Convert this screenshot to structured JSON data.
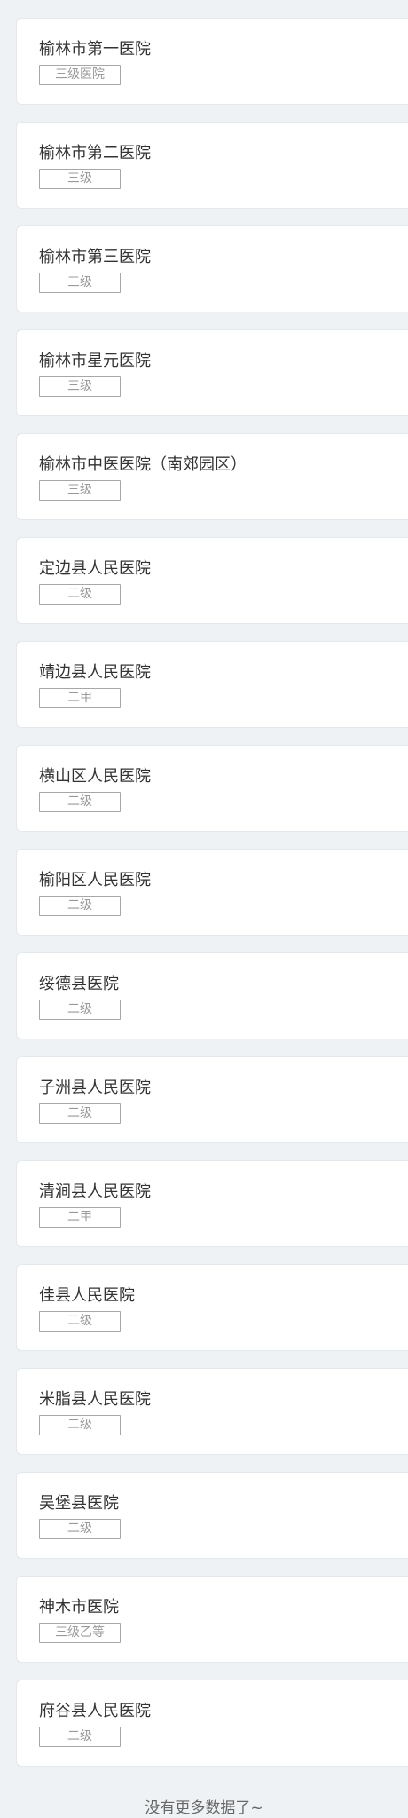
{
  "hospitals": [
    {
      "name": "榆林市第一医院",
      "level": "三级医院"
    },
    {
      "name": "榆林市第二医院",
      "level": "三级"
    },
    {
      "name": "榆林市第三医院",
      "level": "三级"
    },
    {
      "name": "榆林市星元医院",
      "level": "三级"
    },
    {
      "name": "榆林市中医医院（南郊园区）",
      "level": "三级"
    },
    {
      "name": "定边县人民医院",
      "level": "二级"
    },
    {
      "name": "靖边县人民医院",
      "level": "二甲"
    },
    {
      "name": "横山区人民医院",
      "level": "二级"
    },
    {
      "name": "榆阳区人民医院",
      "level": "二级"
    },
    {
      "name": "绥德县医院",
      "level": "二级"
    },
    {
      "name": "子洲县人民医院",
      "level": "二级"
    },
    {
      "name": "清涧县人民医院",
      "level": "二甲"
    },
    {
      "name": "佳县人民医院",
      "level": "二级"
    },
    {
      "name": "米脂县人民医院",
      "level": "二级"
    },
    {
      "name": "吴堡县医院",
      "level": "二级"
    },
    {
      "name": "神木市医院",
      "level": "三级乙等"
    },
    {
      "name": "府谷县人民医院",
      "level": "二级"
    }
  ],
  "footer": {
    "text": "没有更多数据了~"
  }
}
